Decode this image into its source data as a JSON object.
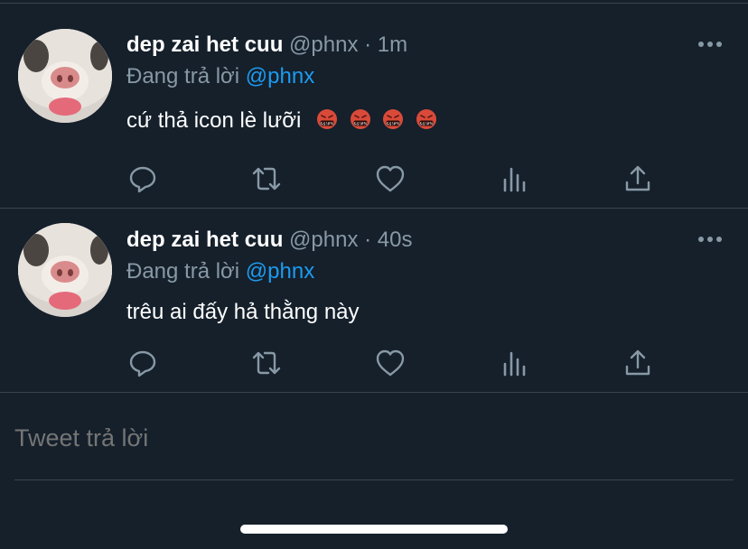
{
  "tweets": [
    {
      "name": "dep zai het cuu",
      "handle": "@phnx",
      "separator": "·",
      "time": "1m",
      "reply_prefix": "Đang trả lời",
      "reply_to": "@phnx",
      "text": "cứ thả icon lè lưỡi",
      "emoji_count": 4,
      "emoji_name": "face-with-symbols-on-mouth"
    },
    {
      "name": "dep zai het cuu",
      "handle": "@phnx",
      "separator": "·",
      "time": "40s",
      "reply_prefix": "Đang trả lời",
      "reply_to": "@phnx",
      "text": "trêu ai đấy hả thằng này",
      "emoji_count": 0
    }
  ],
  "actions": [
    "reply-icon",
    "retweet-icon",
    "like-icon",
    "analytics-icon",
    "share-icon"
  ],
  "reply_box": {
    "placeholder": "Tweet trả lời"
  },
  "colors": {
    "background": "#15202b",
    "text": "#ffffff",
    "secondary": "#8899a6",
    "accent": "#1d9bf0",
    "divider": "#38444d"
  }
}
